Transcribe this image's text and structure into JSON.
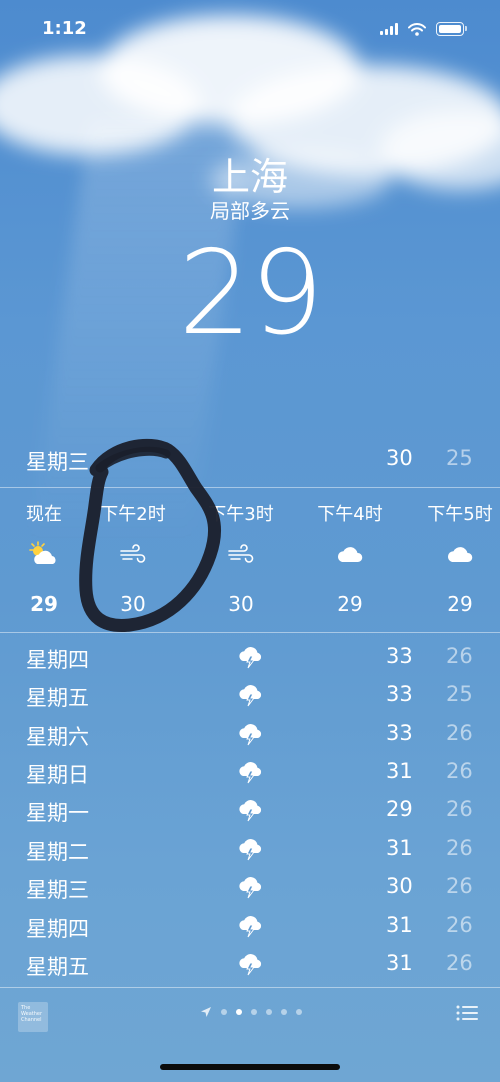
{
  "status": {
    "time": "1:12"
  },
  "header": {
    "city": "上海",
    "condition": "局部多云",
    "temperature": "29"
  },
  "today": {
    "day": "星期三",
    "high": "30",
    "low": "25"
  },
  "hourly": [
    {
      "label": "现在",
      "icon": "partly-sunny-icon",
      "temp": "29"
    },
    {
      "label": "下午2时",
      "icon": "wind-icon",
      "temp": "30"
    },
    {
      "label": "下午3时",
      "icon": "wind-icon",
      "temp": "30"
    },
    {
      "label": "下午4时",
      "icon": "cloud-icon",
      "temp": "29"
    },
    {
      "label": "下午5时",
      "icon": "cloud-icon",
      "temp": "29"
    }
  ],
  "daily": [
    {
      "day": "星期四",
      "icon": "thunderstorm-icon",
      "high": "33",
      "low": "26"
    },
    {
      "day": "星期五",
      "icon": "thunderstorm-icon",
      "high": "33",
      "low": "25"
    },
    {
      "day": "星期六",
      "icon": "thunderstorm-icon",
      "high": "33",
      "low": "26"
    },
    {
      "day": "星期日",
      "icon": "thunderstorm-icon",
      "high": "31",
      "low": "26"
    },
    {
      "day": "星期一",
      "icon": "thunderstorm-icon",
      "high": "29",
      "low": "26"
    },
    {
      "day": "星期二",
      "icon": "thunderstorm-icon",
      "high": "31",
      "low": "26"
    },
    {
      "day": "星期三",
      "icon": "thunderstorm-icon",
      "high": "30",
      "low": "26"
    },
    {
      "day": "星期四",
      "icon": "thunderstorm-icon",
      "high": "31",
      "low": "26"
    },
    {
      "day": "星期五",
      "icon": "thunderstorm-icon",
      "high": "31",
      "low": "26"
    }
  ],
  "footer": {
    "logo_text": [
      "The",
      "Weather",
      "Channel"
    ],
    "page_count": 6,
    "active_page": 1
  },
  "colors": {
    "background_top": "#4d8bcf",
    "background_bottom": "#6fa6d3",
    "low_temp": "rgba(255,255,255,0.55)"
  }
}
